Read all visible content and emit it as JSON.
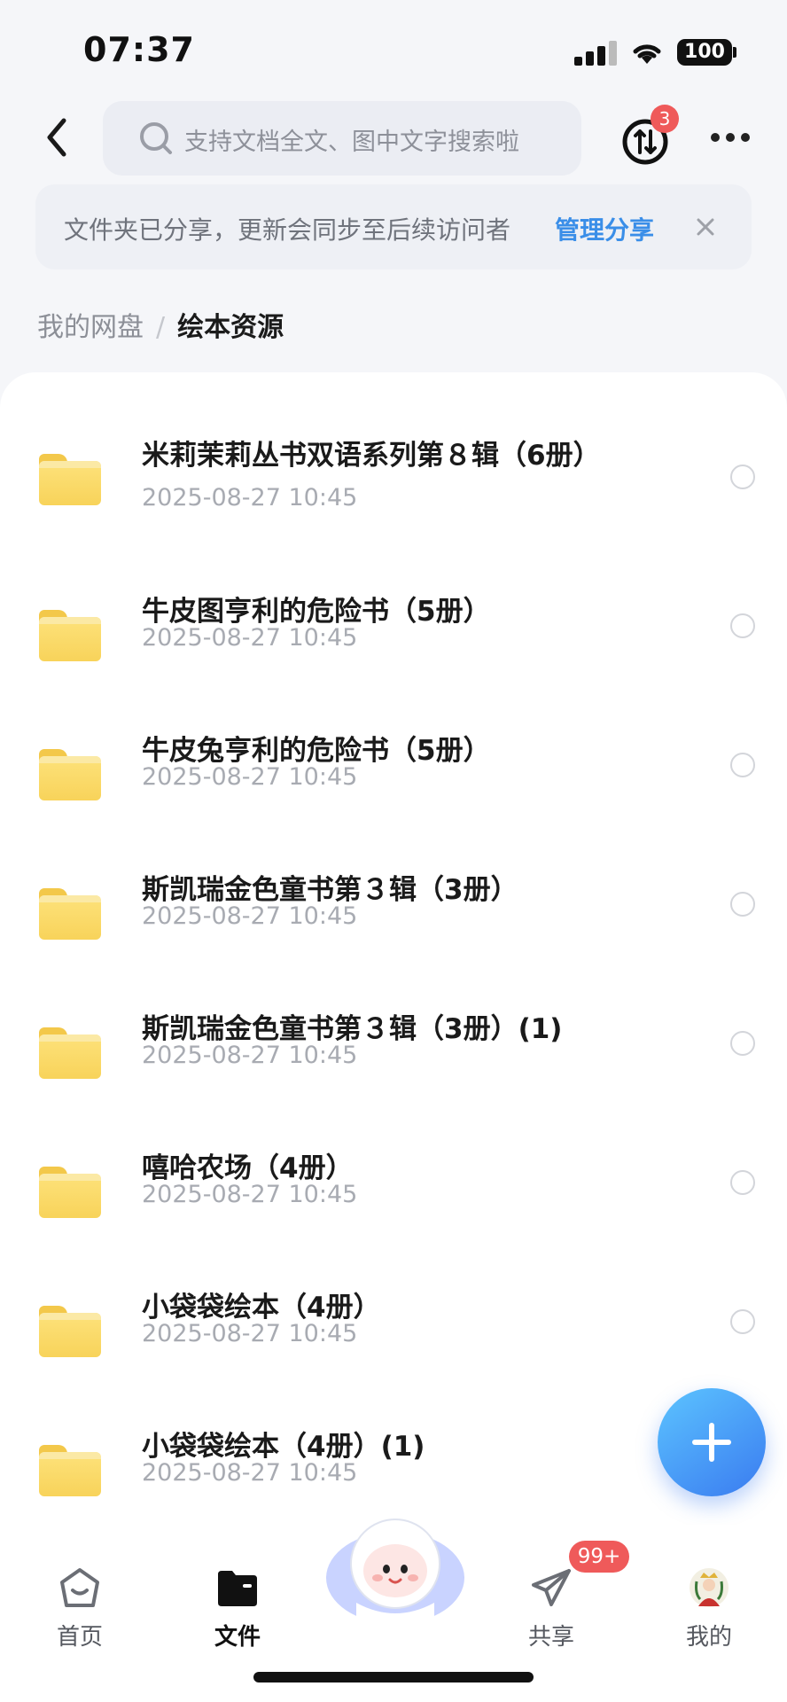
{
  "status_bar": {
    "time": "07:37",
    "battery": "100"
  },
  "header": {
    "search_placeholder": "支持文档全文、图中文字搜索啦",
    "sync_badge": "3"
  },
  "notice": {
    "text": "文件夹已分享，更新会同步至后续访问者",
    "link": "管理分享"
  },
  "breadcrumb": {
    "root": "我的网盘",
    "separator": "/",
    "current": "绘本资源"
  },
  "files": [
    {
      "name": "米莉茉莉丛书双语系列第８辑（6册）",
      "date": "2025-08-27 10:45"
    },
    {
      "name": "牛皮图亨利的危险书（5册）",
      "date": "2025-08-27 10:45"
    },
    {
      "name": "牛皮兔亨利的危险书（5册）",
      "date": "2025-08-27 10:45"
    },
    {
      "name": "斯凯瑞金色童书第３辑（3册）",
      "date": "2025-08-27 10:45"
    },
    {
      "name": "斯凯瑞金色童书第３辑（3册）(1)",
      "date": "2025-08-27 10:45"
    },
    {
      "name": "嘻哈农场（4册）",
      "date": "2025-08-27 10:45"
    },
    {
      "name": "小袋袋绘本（4册）",
      "date": "2025-08-27 10:45"
    },
    {
      "name": "小袋袋绘本（4册）(1)",
      "date": "2025-08-27 10:45"
    }
  ],
  "tabbar": {
    "home": "首页",
    "files": "文件",
    "share": "共享",
    "share_badge": "99+",
    "mine": "我的"
  },
  "colors": {
    "accent": "#3a8ee8",
    "badge": "#ef5a5a",
    "folder": "#f8d35a"
  },
  "icons": [
    "back-arrow-icon",
    "search-icon",
    "sync-icon",
    "more-icon",
    "close-icon",
    "folder-icon",
    "plus-icon",
    "home-icon",
    "files-icon",
    "share-plane-icon",
    "avatar-icon"
  ]
}
